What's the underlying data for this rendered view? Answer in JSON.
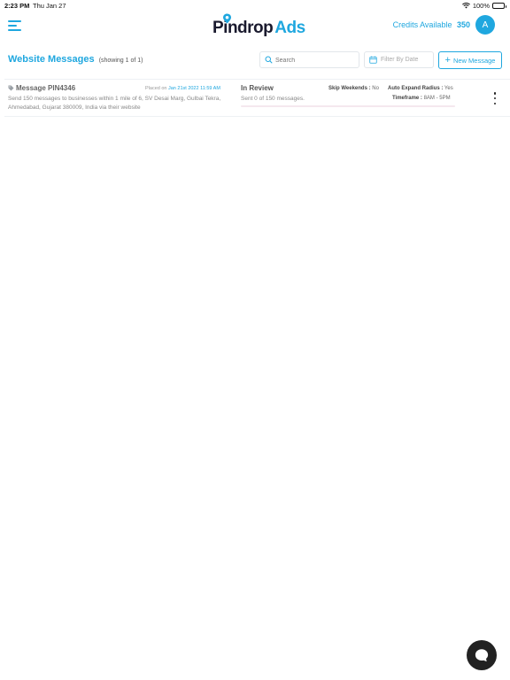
{
  "status_bar": {
    "time": "2:23 PM",
    "date": "Thu Jan 27",
    "battery_text": "100%",
    "battery_level": 1.0
  },
  "header": {
    "logo_part1": "Pindrop",
    "logo_part2": "Ads",
    "credits_label": "Credits Available",
    "credits_value": "350",
    "avatar_initial": "A"
  },
  "toolbar": {
    "title": "Website Messages",
    "subtitle": "(showing 1 of 1)",
    "search_placeholder": "Search",
    "date_placeholder": "Filter By Date",
    "new_label": "New Message"
  },
  "messages": [
    {
      "id": "Message PIN4346",
      "placed_label": "Placed on",
      "placed_date": "Jan 21st 2022 11:59 AM",
      "description": "Send 150 messages to businesses within 1 mile of 6, SV Desai Marg, Gulbai Tekra, Ahmedabad, Gujarat 380009, India via their website",
      "status": "In Review",
      "sent_text": "Sent 0 of 150 messages.",
      "progress": 0,
      "skip_label": "Skip Weekends :",
      "skip_value": "No",
      "expand_label": "Auto Expand Radius :",
      "expand_value": "Yes",
      "timeframe_label": "Timeframe :",
      "timeframe_value": "8AM - 5PM"
    }
  ],
  "colors": {
    "accent": "#1fa7df",
    "dark": "#1a1a2e",
    "chat_button": "#222222"
  },
  "icons": [
    "menu-icon",
    "map-pin-icon",
    "search-icon",
    "calendar-icon",
    "plus-icon",
    "tag-icon",
    "more-vertical-icon",
    "chat-icon",
    "wifi-icon",
    "battery-icon"
  ]
}
